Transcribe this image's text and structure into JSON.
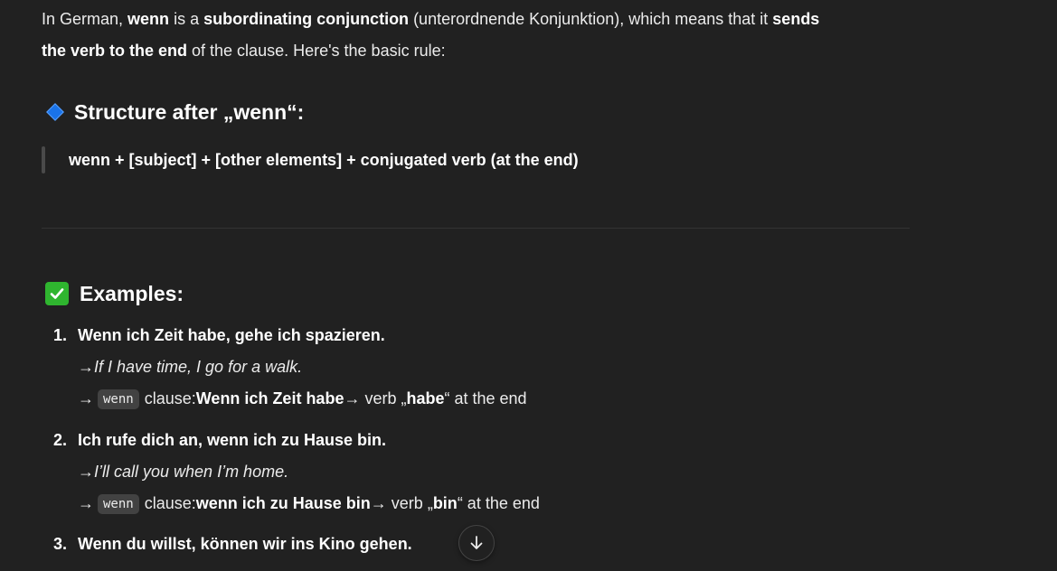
{
  "intro": {
    "p1": "In German, ",
    "b1": "wenn",
    "p2": " is a ",
    "b2": "subordinating conjunction",
    "p3": " (unterordnende Konjunktion), which means that it ",
    "b3": "sends",
    "b4": "the verb to the end",
    "p4": " of the clause. Here's the basic rule:"
  },
  "structure": {
    "heading": "Structure after „wenn“:",
    "icon": "blue-diamond-icon",
    "rule": "wenn + [subject] + [other elements] + conjugated verb (at the end)"
  },
  "examples": {
    "heading": "Examples:",
    "icon": "check-mark-icon",
    "items": [
      {
        "number": "1.",
        "sentence": "Wenn ich Zeit habe, gehe ich spazieren.",
        "arrow1": "→ ",
        "translation": "If I have time, I go for a walk.",
        "arrow2": "→",
        "code": "wenn",
        "clause_label": "clause: ",
        "clause": "Wenn ich Zeit habe",
        "verb_pre": " → verb „",
        "verb": "habe",
        "verb_post": "“ at the end"
      },
      {
        "number": "2.",
        "sentence": "Ich rufe dich an, wenn ich zu Hause bin.",
        "arrow1": "→ ",
        "translation": "I’ll call you when I’m home.",
        "arrow2": "→",
        "code": "wenn",
        "clause_label": "clause: ",
        "clause": "wenn ich zu Hause bin",
        "verb_pre": " → verb „",
        "verb": "bin",
        "verb_post": "“ at the end"
      },
      {
        "number": "3.",
        "sentence": "Wenn du willst, können wir ins Kino gehen."
      }
    ]
  },
  "scroll_button": {
    "icon": "arrow-down-icon"
  },
  "colors": {
    "background": "#212121",
    "text": "#ececec",
    "accent_blue": "#1a73e8",
    "check_green": "#2fb52f"
  }
}
